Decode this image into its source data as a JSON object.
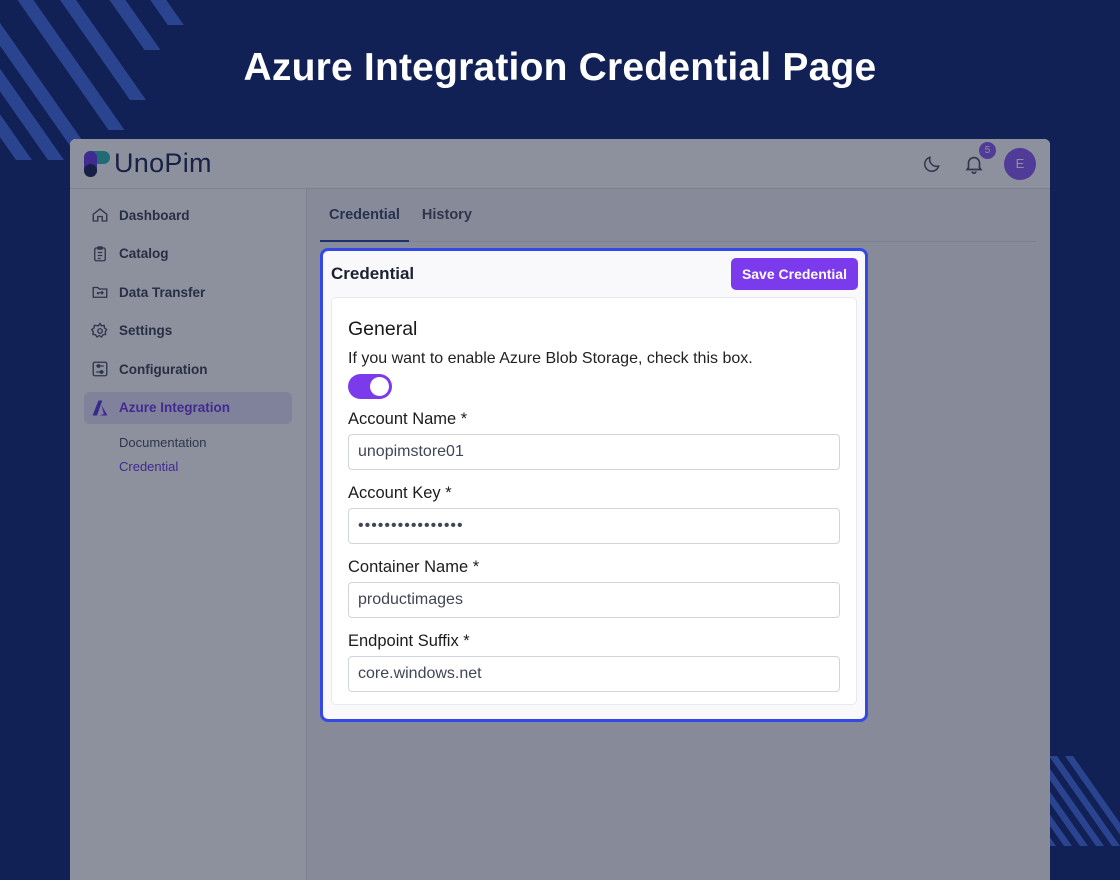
{
  "hero": {
    "title": "Azure Integration Credential Page"
  },
  "topbar": {
    "logo_text": "UnoPim",
    "notification_count": "5",
    "avatar_initial": "E"
  },
  "sidebar": {
    "items": [
      {
        "label": "Dashboard",
        "icon": "home-icon"
      },
      {
        "label": "Catalog",
        "icon": "clipboard-icon"
      },
      {
        "label": "Data Transfer",
        "icon": "folder-transfer-icon"
      },
      {
        "label": "Settings",
        "icon": "gear-icon"
      },
      {
        "label": "Configuration",
        "icon": "sliders-icon"
      },
      {
        "label": "Azure Integration",
        "icon": "azure-logo-icon",
        "active": true
      }
    ],
    "sub_items": [
      {
        "label": "Documentation"
      },
      {
        "label": "Credential",
        "active": true
      }
    ]
  },
  "tabs": [
    {
      "label": "Credential",
      "active": true
    },
    {
      "label": "History"
    }
  ],
  "card": {
    "title": "Credential",
    "save_label": "Save Credential",
    "section_title": "General",
    "hint": "If you want to enable Azure Blob Storage, check this box.",
    "toggle_on": true,
    "fields": [
      {
        "label": "Account Name *",
        "value": "unopimstore01"
      },
      {
        "label": "Account Key *",
        "value": "••••••••••••••••"
      },
      {
        "label": "Container Name *",
        "value": "productimages"
      },
      {
        "label": "Endpoint Suffix *",
        "value": "core.windows.net"
      }
    ]
  },
  "colors": {
    "background": "#112155",
    "accent": "#7c3aed",
    "highlight_border": "#3448e6"
  }
}
